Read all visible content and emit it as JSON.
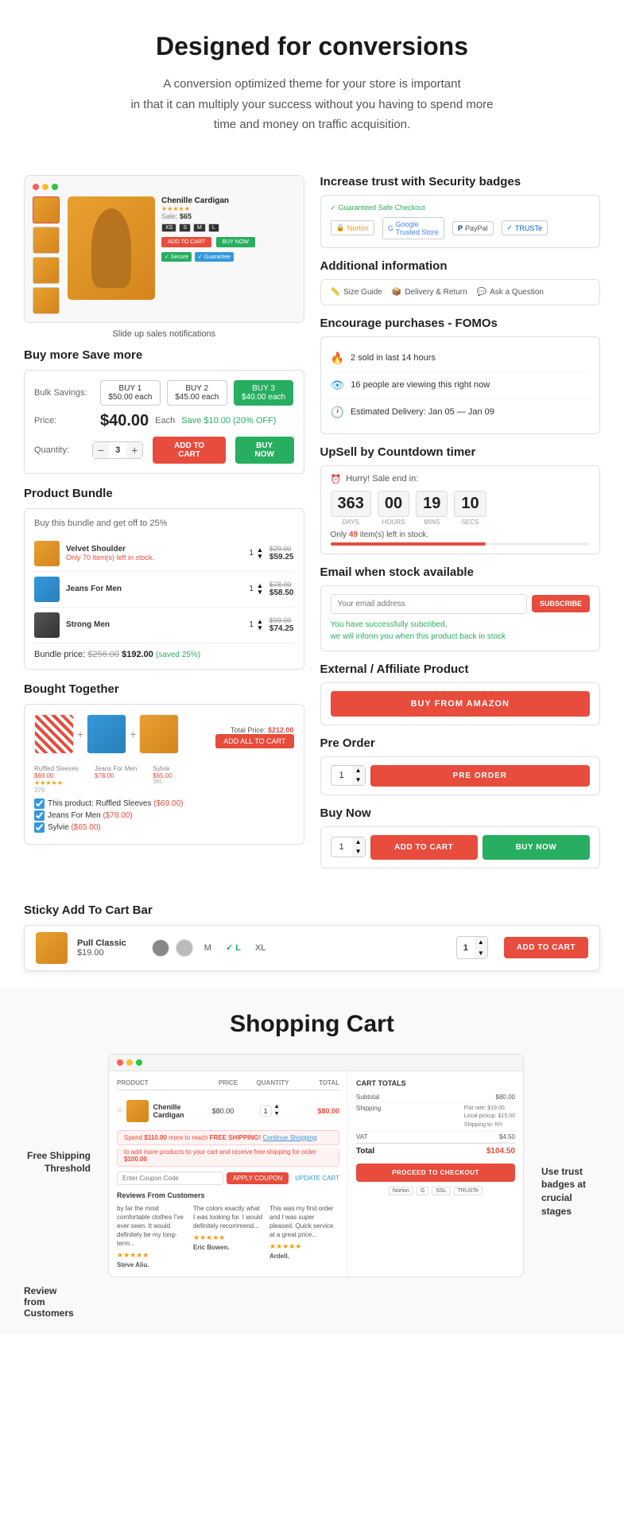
{
  "hero": {
    "title": "Designed for conversions",
    "description_line1": "A conversion optimized theme for your store is important",
    "description_line2": "in that it can multiply your success without you having to spend more",
    "description_line3": "time and money on traffic acquisition."
  },
  "product_mockup": {
    "title": "Chenille Cardigan",
    "original_price": "$65",
    "price": "$65",
    "sizes": [
      "XS",
      "S",
      "M",
      "L"
    ],
    "notification_label": "Slide up sales notifications"
  },
  "buy_more": {
    "heading": "Buy more Save more",
    "bulk_label": "Bulk Savings:",
    "options": [
      {
        "label": "BUY 1",
        "price": "$50.00 each"
      },
      {
        "label": "BUY 2",
        "price": "$45.00 each"
      },
      {
        "label": "BUY 3",
        "price": "$40.00 each",
        "selected": true
      }
    ],
    "price_label": "Price:",
    "price": "$40.00",
    "each": "Each",
    "save": "Save $10.00 (20% OFF)",
    "qty_label": "Quantity:",
    "qty": "3",
    "add_to_cart": "ADD TO CART",
    "buy_now": "BUY NOW"
  },
  "product_bundle": {
    "heading": "Product Bundle",
    "subtitle": "Buy this bundle and get off to 25%",
    "items": [
      {
        "name": "Velvet Shoulder",
        "stock": "Only 70 item(s) left in stock.",
        "qty": "1",
        "original_price": "$29.00",
        "price": "$59.25",
        "color": "orange"
      },
      {
        "name": "Jeans For Men",
        "stock": "",
        "qty": "1",
        "original_price": "$78.00",
        "price": "$58.50",
        "color": "blue"
      },
      {
        "name": "Strong Men",
        "stock": "",
        "qty": "1",
        "original_price": "$99.00",
        "price": "$74.25",
        "color": "dark"
      }
    ],
    "bundle_total_label": "Bundle price:",
    "bundle_original": "$256.00",
    "bundle_price": "$192.00",
    "bundle_saved": "(saved 25%)"
  },
  "bought_together": {
    "heading": "Bought Together",
    "total_price_label": "Total Price:",
    "total_price": "$212.00",
    "add_all_label": "ADD ALL TO CART",
    "items": [
      {
        "name": "Ruffled Sleeves",
        "price": "$69.00"
      },
      {
        "name": "Jeans For Men",
        "price": "$78.00"
      },
      {
        "name": "Sylvie",
        "price": "$65.00"
      }
    ],
    "this_product_label": "This product: Ruffled Sleeves",
    "this_product_price": "($69.00)",
    "item2_label": "Jeans For Men",
    "item2_price": "($78.00)",
    "item3_label": "Sylvie",
    "item3_price": "($65.00)"
  },
  "security_badges": {
    "heading": "Increase trust with Security badges",
    "guaranteed_label": "Guaranteed Safe Checkout",
    "badges": [
      "Norton",
      "Google Trusted Store",
      "PayPal",
      "TRUSTe"
    ]
  },
  "additional_info": {
    "heading": "Additional information",
    "links": [
      "Size Guide",
      "Delivery & Return",
      "Ask a Question"
    ]
  },
  "fomo": {
    "heading": "Encourage purchases - FOMOs",
    "item1": "2 sold in last 14 hours",
    "item2": "16 people are viewing this right now",
    "item3": "Estimated Delivery: Jan 05 — Jan 09"
  },
  "countdown": {
    "heading": "UpSell by Countdown timer",
    "hurry_text": "Hurry! Sale end in:",
    "days": "363",
    "hours": "00",
    "mins": "19",
    "secs": "10",
    "days_label": "DAYS",
    "hours_label": "HOURS",
    "mins_label": "MINS",
    "secs_label": "SECS",
    "stock_text": "Only 49 item(s) left in stock."
  },
  "email_stock": {
    "heading": "Email when stock available",
    "placeholder": "Your email address",
    "subscribe_label": "SUBSCRIBE",
    "success_text": "You have successfully subcribed,\nwe will inform you when this product back in stock"
  },
  "affiliate": {
    "heading": "External / Affiliate Product",
    "btn_label": "BUY FROM AMAZON"
  },
  "pre_order": {
    "heading": "Pre Order",
    "qty": "1",
    "btn_label": "PRE ORDER"
  },
  "buy_now_section": {
    "heading": "Buy Now",
    "qty": "1",
    "add_to_cart_label": "ADD TO CART",
    "buy_now_label": "BUY NOW"
  },
  "sticky_bar": {
    "heading": "Sticky Add To Cart Bar",
    "product_name": "Pull Classic",
    "product_price": "$19.00",
    "sizes": [
      "M",
      "L",
      "XL"
    ],
    "selected_size": "L",
    "qty": "1",
    "add_to_cart_label": "ADD TO CART"
  },
  "shopping_cart": {
    "heading": "Shopping Cart",
    "left_labels": {
      "free_shipping": "Free Shipping Threshold",
      "review": "Review\nfrom\nCustomers"
    },
    "right_labels": {
      "trust": "Use trust\nbadges at\ncrucial stages"
    },
    "table_headers": [
      "PRODUCT",
      "PRICE",
      "QUANTITY",
      "TOTAL"
    ],
    "cart_item": {
      "name": "Chenille Cardigan",
      "price": "$80.00",
      "qty": "1",
      "total": "$80.00"
    },
    "free_shipping_bar": "Spend $110.00 more to reach FREE SHIPPING! Continue Shopping",
    "free_shipping_bar2": "to add more products to your cart and receive free shipping for order $100.00",
    "coupon_placeholder": "Enter Coupon Code",
    "apply_coupon_label": "APPLY COUPON",
    "update_cart_label": "UPDATE CART",
    "reviews_title": "Reviews From Customers",
    "reviews": [
      {
        "text": "by far the most comfortable clothes I've ever seen. It would definitely be my long-term...",
        "stars": "★★★★★",
        "author": "Steve Aliu."
      },
      {
        "text": "The colors exactly what I was looking for. I would definitely recommend...",
        "stars": "★★★★★",
        "author": "Eric Bowen."
      },
      {
        "text": "This was my first order and I was super pleased. Quick service at a great price...",
        "stars": "★★★★★",
        "author": "Ardell."
      }
    ],
    "totals": {
      "title": "CART TOTALS",
      "subtotal_label": "Subtotal",
      "subtotal": "$80.00",
      "shipping_label": "Shipping",
      "shipping_detail1": "Flat rate: $19.00",
      "shipping_detail2": "Local pickup: $15.00",
      "shipping_detail3": "Shipping to: NY",
      "vat_label": "VAT",
      "vat": "$4.50",
      "total_label": "Total",
      "total": "$104.50",
      "checkout_label": "PROCEED TO CHECKOUT"
    }
  }
}
